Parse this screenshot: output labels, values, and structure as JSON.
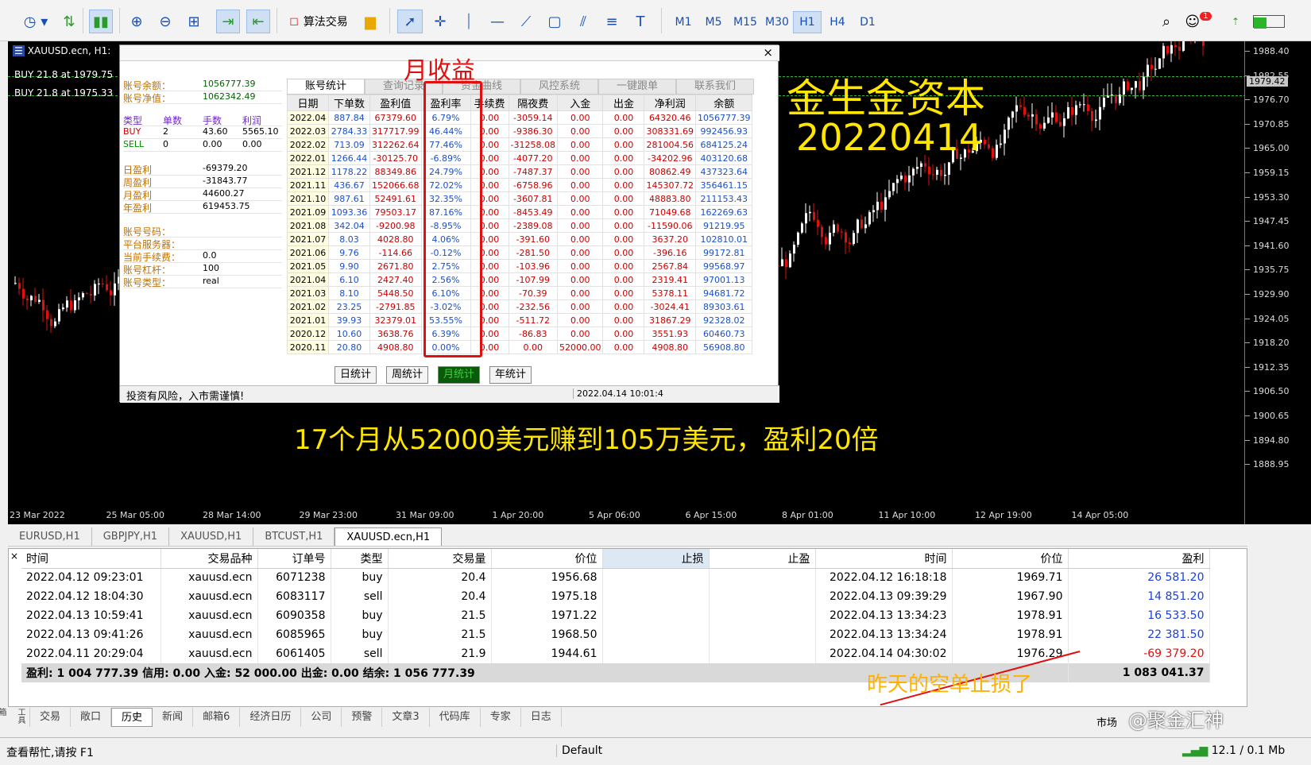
{
  "toolbar": {
    "algo_label": "算法交易",
    "timeframes": [
      "M1",
      "M5",
      "M15",
      "M30",
      "H1",
      "H4",
      "D1"
    ],
    "active_tf": "H1",
    "notif_count": "1"
  },
  "chart": {
    "title": "XAUUSD.ecn, H1:",
    "buy_lines": [
      "BUY 21.8 at 1979.75",
      "BUY 21.8 at 1975.33"
    ],
    "caption1": "金生金资本",
    "caption2": "20220414",
    "caption3": "17个月从52000美元赚到105万美元，盈利20倍",
    "month_label": "月收益",
    "bottom_note": "昨天的空单止损了",
    "current_price": "1979.42",
    "price_ticks": [
      "1988.40",
      "1982.55",
      "1976.70",
      "1970.85",
      "1965.00",
      "1959.15",
      "1953.30",
      "1947.45",
      "1941.60",
      "1935.75",
      "1929.90",
      "1924.05",
      "1918.20",
      "1912.35",
      "1906.50",
      "1900.65",
      "1894.80",
      "1888.95"
    ],
    "time_ticks": [
      "23 Mar 2022",
      "25 Mar 05:00",
      "28 Mar 14:00",
      "29 Mar 23:00",
      "31 Mar 09:00",
      "1 Apr 20:00",
      "5 Apr 06:00",
      "6 Apr 15:00",
      "8 Apr 01:00",
      "11 Apr 10:00",
      "12 Apr 19:00",
      "14 Apr 05:00"
    ]
  },
  "panel": {
    "account": [
      {
        "k": "账号余额：",
        "v": "1056777.39"
      },
      {
        "k": "账号净值：",
        "v": "1062342.49"
      }
    ],
    "pos_headers": [
      "类型",
      "单数",
      "手数",
      "利润"
    ],
    "positions": [
      [
        "BUY",
        "2",
        "43.60",
        "5565.10"
      ],
      [
        "SELL",
        "0",
        "0.00",
        "0.00"
      ]
    ],
    "profits": [
      {
        "k": "日盈利",
        "v": "-69379.20"
      },
      {
        "k": "周盈利",
        "v": "-31843.77"
      },
      {
        "k": "月盈利",
        "v": "44600.27"
      },
      {
        "k": "年盈利",
        "v": "619453.75"
      }
    ],
    "info": [
      {
        "k": "账号号码：",
        "v": ""
      },
      {
        "k": "平台服务器：",
        "v": ""
      },
      {
        "k": "当前手续费：",
        "v": "0.0"
      },
      {
        "k": "账号杠杆：",
        "v": "100"
      },
      {
        "k": "账号类型：",
        "v": "real"
      }
    ],
    "tabs": [
      "账号统计",
      "查询记录",
      "资金曲线",
      "风控系统",
      "一键跟单",
      "联系我们"
    ],
    "headers": [
      "日期",
      "下单数",
      "盈利值",
      "盈利率",
      "手续费",
      "隔夜费",
      "入金",
      "出金",
      "净利润",
      "余额"
    ],
    "rows": [
      [
        "2022.04",
        "887.84",
        "67379.60",
        "6.79%",
        "0.00",
        "-3059.14",
        "0.00",
        "0.00",
        "64320.46",
        "1056777.39"
      ],
      [
        "2022.03",
        "2784.33",
        "317717.99",
        "46.44%",
        "0.00",
        "-9386.30",
        "0.00",
        "0.00",
        "308331.69",
        "992456.93"
      ],
      [
        "2022.02",
        "713.09",
        "312262.64",
        "77.46%",
        "0.00",
        "-31258.08",
        "0.00",
        "0.00",
        "281004.56",
        "684125.24"
      ],
      [
        "2022.01",
        "1266.44",
        "-30125.70",
        "-6.89%",
        "0.00",
        "-4077.20",
        "0.00",
        "0.00",
        "-34202.96",
        "403120.68"
      ],
      [
        "2021.12",
        "1178.22",
        "88349.86",
        "24.79%",
        "0.00",
        "-7487.37",
        "0.00",
        "0.00",
        "80862.49",
        "437323.64"
      ],
      [
        "2021.11",
        "436.67",
        "152066.68",
        "72.02%",
        "0.00",
        "-6758.96",
        "0.00",
        "0.00",
        "145307.72",
        "356461.15"
      ],
      [
        "2021.10",
        "987.61",
        "52491.61",
        "32.35%",
        "0.00",
        "-3607.81",
        "0.00",
        "0.00",
        "48883.80",
        "211153.43"
      ],
      [
        "2021.09",
        "1093.36",
        "79503.17",
        "87.16%",
        "0.00",
        "-8453.49",
        "0.00",
        "0.00",
        "71049.68",
        "162269.63"
      ],
      [
        "2021.08",
        "342.04",
        "-9200.98",
        "-8.95%",
        "0.00",
        "-2389.08",
        "0.00",
        "0.00",
        "-11590.06",
        "91219.95"
      ],
      [
        "2021.07",
        "8.03",
        "4028.80",
        "4.06%",
        "0.00",
        "-391.60",
        "0.00",
        "0.00",
        "3637.20",
        "102810.01"
      ],
      [
        "2021.06",
        "9.76",
        "-114.66",
        "-0.12%",
        "0.00",
        "-281.50",
        "0.00",
        "0.00",
        "-396.16",
        "99172.81"
      ],
      [
        "2021.05",
        "9.90",
        "2671.80",
        "2.75%",
        "0.00",
        "-103.96",
        "0.00",
        "0.00",
        "2567.84",
        "99568.97"
      ],
      [
        "2021.04",
        "6.10",
        "2427.40",
        "2.56%",
        "0.00",
        "-107.99",
        "0.00",
        "0.00",
        "2319.41",
        "97001.13"
      ],
      [
        "2021.03",
        "8.10",
        "5448.50",
        "6.10%",
        "0.00",
        "-70.39",
        "0.00",
        "0.00",
        "5378.11",
        "94681.72"
      ],
      [
        "2021.02",
        "23.25",
        "-2791.85",
        "-3.02%",
        "0.00",
        "-232.56",
        "0.00",
        "0.00",
        "-3024.41",
        "89303.61"
      ],
      [
        "2021.01",
        "39.93",
        "32379.01",
        "53.55%",
        "0.00",
        "-511.72",
        "0.00",
        "0.00",
        "31867.29",
        "92328.02"
      ],
      [
        "2020.12",
        "10.60",
        "3638.76",
        "6.39%",
        "0.00",
        "-86.83",
        "0.00",
        "0.00",
        "3551.93",
        "60460.73"
      ],
      [
        "2020.11",
        "20.80",
        "4908.80",
        "0.00%",
        "0.00",
        "0.00",
        "52000.00",
        "0.00",
        "4908.80",
        "56908.80"
      ]
    ],
    "buttons": [
      "日统计",
      "周统计",
      "月统计",
      "年统计"
    ],
    "risk": "投资有风险，入市需谨慎!",
    "time": "2022.04.14 10:01:4"
  },
  "chart_tabs": [
    "EURUSD,H1",
    "GBPJPY,H1",
    "XAUUSD,H1",
    "BTCUST,H1",
    "XAUUSD.ecn,H1"
  ],
  "terminal": {
    "headers": [
      "时间",
      "交易品种",
      "订单号",
      "类型",
      "交易量",
      "价位",
      "止损",
      "止盈",
      "时间",
      "价位",
      "盈利"
    ],
    "rows": [
      [
        "2022.04.12 09:23:01",
        "xauusd.ecn",
        "6071238",
        "buy",
        "20.4",
        "1956.68",
        "",
        "",
        "2022.04.12 16:18:18",
        "1969.71",
        "26 581.20"
      ],
      [
        "2022.04.12 18:04:30",
        "xauusd.ecn",
        "6083117",
        "sell",
        "20.4",
        "1975.18",
        "",
        "",
        "2022.04.13 09:39:29",
        "1967.90",
        "14 851.20"
      ],
      [
        "2022.04.13 10:59:41",
        "xauusd.ecn",
        "6090358",
        "buy",
        "21.5",
        "1971.22",
        "",
        "",
        "2022.04.13 13:34:23",
        "1978.91",
        "16 533.50"
      ],
      [
        "2022.04.13 09:41:26",
        "xauusd.ecn",
        "6085965",
        "buy",
        "21.5",
        "1968.50",
        "",
        "",
        "2022.04.13 13:34:24",
        "1978.91",
        "22 381.50"
      ],
      [
        "2022.04.11 20:29:04",
        "xauusd.ecn",
        "6061405",
        "sell",
        "21.9",
        "1944.61",
        "",
        "",
        "2022.04.14 04:30:02",
        "1976.29",
        "-69 379.20"
      ]
    ],
    "summary": "盈利: 1 004 777.39  信用: 0.00  入金: 52 000.00  出金: 0.00  结余: 1 056 777.39",
    "summary_total": "1 083 041.37"
  },
  "bottom_tabs": [
    "交易",
    "敞口",
    "历史",
    "新闻",
    "邮箱6",
    "经济日历",
    "公司",
    "预警",
    "文章3",
    "代码库",
    "专家",
    "日志"
  ],
  "status": {
    "help": "查看帮忙,请按 F1",
    "profile": "Default",
    "speed": "12.1 / 0.1 Mb",
    "market": "市场",
    "watermark": "@聚金汇神"
  }
}
